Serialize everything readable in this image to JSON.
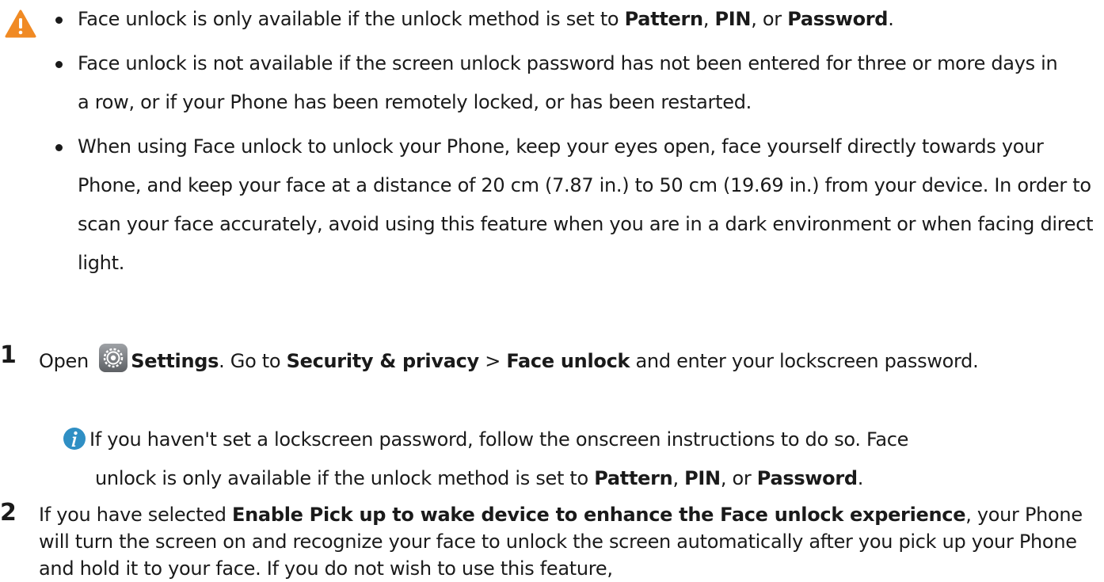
{
  "warning": {
    "bullets": [
      {
        "parts": [
          "Face unlock is only available if the unlock method is set to ",
          "Pattern",
          ", ",
          "PIN",
          ", or ",
          "Password",
          "."
        ]
      },
      {
        "parts": [
          "Face unlock is not available if the screen unlock password has not been entered for three or more days in a row, or if your Phone has been remotely locked, or has been restarted."
        ]
      },
      {
        "parts": [
          "When using Face unlock to unlock your Phone, keep your eyes open, face yourself directly towards your Phone, and keep your face at a distance of 20 cm (7.87 in.) to 50 cm (19.69 in.) from your device. In order to scan your face accurately, avoid using this feature when you are in a dark environment or when facing direct light."
        ]
      }
    ]
  },
  "steps": [
    {
      "number": "1",
      "t1": "Open ",
      "settings": "Settings",
      "t2": ". Go to ",
      "security": "Security & privacy",
      "t3": " > ",
      "face_unlock": "Face unlock",
      "t4": " and enter your lockscreen password."
    },
    {
      "number": "2",
      "t1": "If you have selected ",
      "enable": "Enable Pick up to wake device to enhance the Face unlock experience",
      "t2": ", your Phone will turn the screen on and recognize your face to unlock the screen automatically after you pick up your Phone and hold it to your face. If you do not wish to use this feature,"
    }
  ],
  "note": {
    "line1": "If you haven't set a lockscreen password, follow the onscreen instructions to do so. Face",
    "line2_a": "unlock is only available if the unlock method is set to ",
    "pattern": "Pattern",
    "comma": ", ",
    "pin": "PIN",
    "or": ", or ",
    "password": "Password",
    "end": "."
  },
  "icons": {
    "warning": "warning-triangle-icon",
    "settings": "settings-gear-icon",
    "info": "info-icon"
  },
  "colors": {
    "warning": "#f08a24",
    "info": "#2f8fc4",
    "text": "#1a1a1a"
  }
}
